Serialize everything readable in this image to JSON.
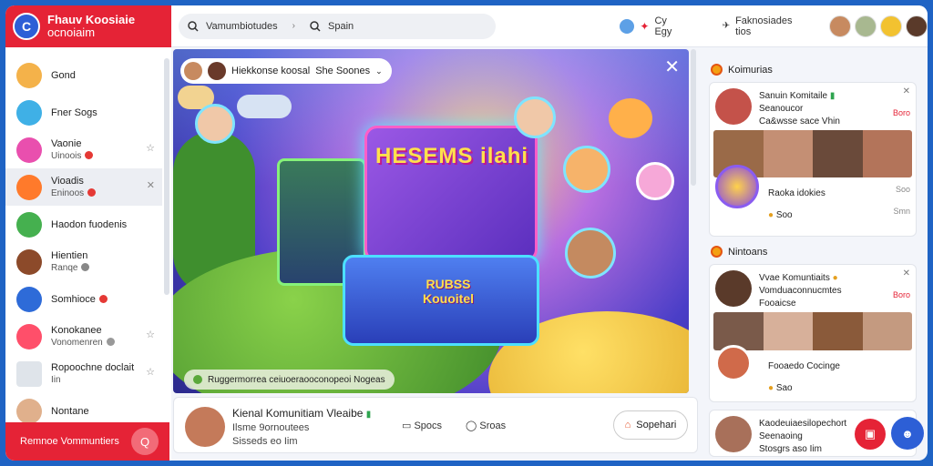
{
  "brand": {
    "line1": "Fhauv Koosiaie",
    "line2": "ocnoiaim",
    "logo_letter": "C"
  },
  "topbar": {
    "search_text": "Vamumbiotudes",
    "search_secondary": "Spain",
    "center_label": "Cy Egy",
    "right_label": "Faknosiades tios"
  },
  "sidebar": {
    "items": [
      {
        "label": "Gond",
        "sub": "",
        "color": "#f4b24a"
      },
      {
        "label": "Fner Sogs",
        "sub": "",
        "color": "#3fb0e6"
      },
      {
        "label": "Vaonie",
        "sub": "Uinoois",
        "color": "#e94fae"
      },
      {
        "label": "Vioadis",
        "sub": "Eninoos",
        "color": "#ff7a2b"
      },
      {
        "label": "Haodon fuodenis",
        "sub": "",
        "color": "#45b04f"
      },
      {
        "label": "Hientien",
        "sub": "Ranqe",
        "color": "#8c4a2a"
      },
      {
        "label": "Somhioce",
        "sub": "",
        "color": "#2e6bd8"
      },
      {
        "label": "Konokanee",
        "sub": "Vonomenren",
        "color": "#ff4f6a"
      },
      {
        "label": "Ropoochne doclait",
        "sub": "Iin",
        "color": "#dfe4ea"
      },
      {
        "label": "Nontane",
        "sub": "",
        "color": "#e0b08c"
      }
    ],
    "bottom_label": "Remnoe Vommuntiers"
  },
  "stage": {
    "chip_label": "Hiekkonse koosal",
    "chip_secondary": "She Soones",
    "portal_title": "HESEMS ilahi",
    "platform_line1": "RUBSS",
    "platform_line2": "Kouoitel",
    "caption": "Ruggermorrea ceiuoeraooconopeoi Nogeas"
  },
  "post": {
    "title": "Kienal Komunitiam Vleaibe",
    "line2": "Ilsme 9ornoutees",
    "line3": "Sisseds eo Iim",
    "action1": "Spocs",
    "action2": "Sroas",
    "share": "Sopehari"
  },
  "right": {
    "section1": "Koimurias",
    "card1": {
      "name": "Sanuin Komitaile",
      "line2": "Seanoucor",
      "line3": "Ca&wsse sace Vhin",
      "join": "Boro",
      "foot_title": "Raoka idokies",
      "foot_sub": "Soo",
      "foot_join1": "Soo",
      "foot_join2": "Smn"
    },
    "section2": "Nintoans",
    "card2": {
      "name": "Vvae Komuntiaits",
      "line2": "Vomduaconnucmtes",
      "line3": "Fooaicse",
      "join": "Boro",
      "foot_title": "Fooaedo Cocinge",
      "foot_sub": "Sao"
    },
    "card3": {
      "name": "Kaodeuiaesilopechort",
      "line2": "Seenaoing",
      "line3": "Stosgrs aso Iim"
    }
  }
}
